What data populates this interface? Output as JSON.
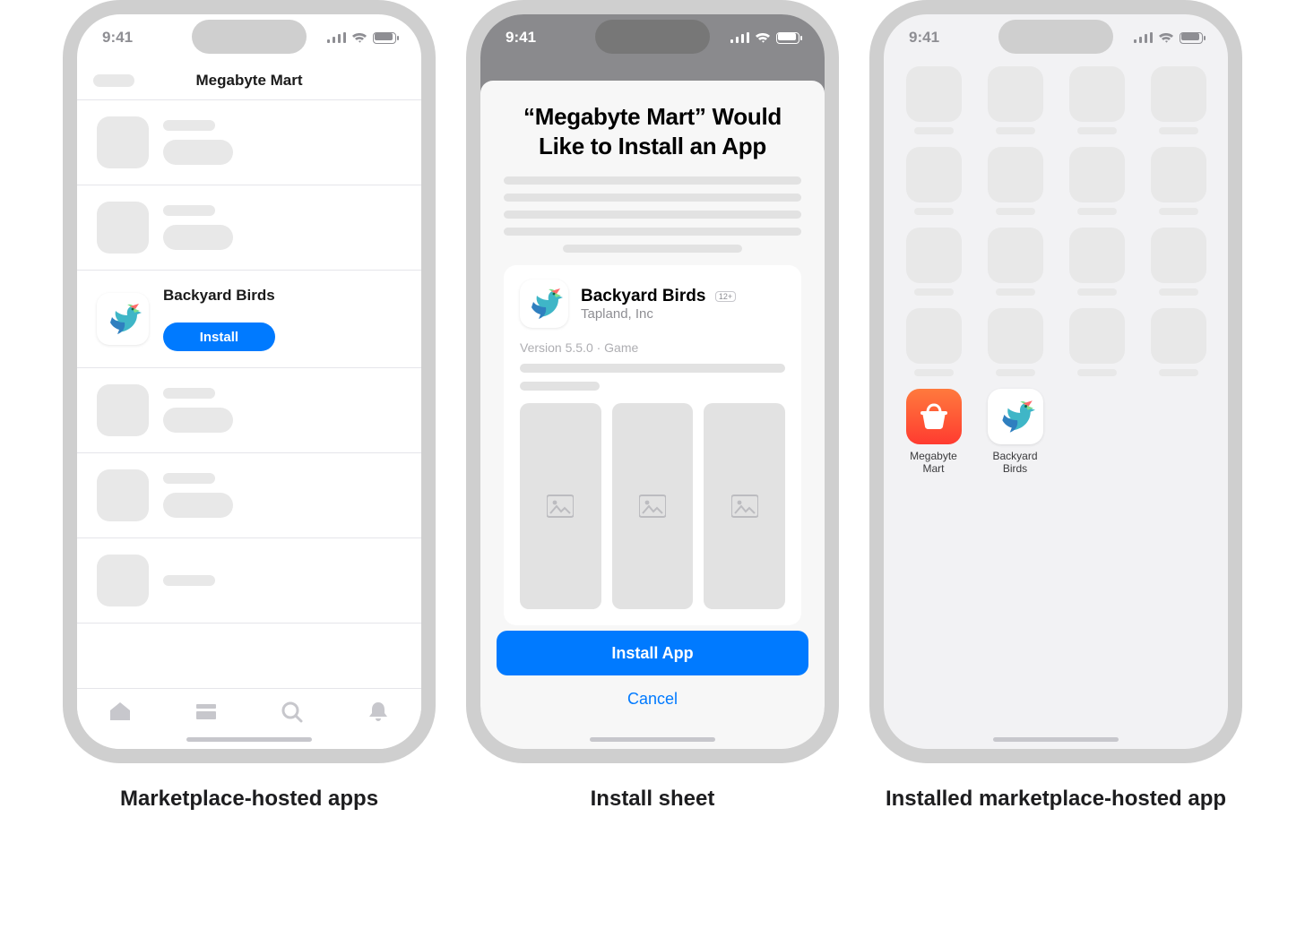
{
  "statusbar": {
    "time": "9:41"
  },
  "captions": {
    "p1": "Marketplace-hosted apps",
    "p2": "Install sheet",
    "p3": "Installed marketplace-hosted app"
  },
  "phone1": {
    "nav_title": "Megabyte Mart",
    "featured_app": {
      "name": "Backyard Birds",
      "install_label": "Install"
    },
    "tabs": [
      "home",
      "browse",
      "search",
      "notifications"
    ]
  },
  "phone2": {
    "sheet_title": "“Megabyte Mart” Would Like to Install an App",
    "app": {
      "name": "Backyard Birds",
      "developer": "Tapland, Inc",
      "age_badge": "12+",
      "meta": "Version 5.5.0 · Game"
    },
    "actions": {
      "install": "Install App",
      "cancel": "Cancel"
    }
  },
  "phone3": {
    "apps": [
      {
        "name": "Megabyte Mart",
        "icon": "basket"
      },
      {
        "name": "Backyard Birds",
        "icon": "bird"
      }
    ]
  }
}
